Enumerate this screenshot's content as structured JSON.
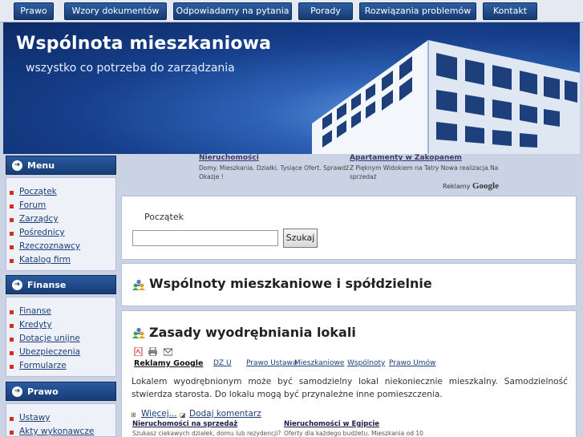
{
  "nav": {
    "items": [
      "Prawo",
      "Wzory dokumentów",
      "Odpowiadamy na pytania",
      "Porady",
      "Rozwiązania problemów",
      "Kontakt"
    ]
  },
  "header": {
    "title": "Wspólnota mieszkaniowa",
    "subtitle": "wszystko co potrzeba do zarządzania"
  },
  "sidebar": {
    "menu": {
      "title": "Menu",
      "items": [
        "Początek",
        "Forum",
        "Zarządcy",
        "Pośrednicy",
        "Rzeczoznawcy",
        "Katalog firm"
      ]
    },
    "finanse": {
      "title": "Finanse",
      "items": [
        "Finanse",
        "Kredyty",
        "Dotacje unijne",
        "Ubezpieczenia",
        "Formularze"
      ]
    },
    "prawo": {
      "title": "Prawo",
      "items": [
        "Ustawy",
        "Akty wykonawcze"
      ]
    }
  },
  "top_ads": [
    {
      "title": "Nieruchomości",
      "text": "Domy. Mieszkania. Działki. Tysiące Ofert. Sprawdź Okazje !"
    },
    {
      "title": "Apartamenty w Zakopanem",
      "text": "Z Pięknym Widokiem na Tatry Nowa realizacja.Na sprzedaż"
    }
  ],
  "reklamy": {
    "prefix": "Reklamy",
    "brand": "Google"
  },
  "search": {
    "breadcrumb": "Początek",
    "value": "",
    "button": "Szukaj"
  },
  "section_title": "Wspólnoty mieszkaniowe i spółdzielnie",
  "article": {
    "title": "Zasady wyodrębniania lokali",
    "ads_label": "Reklamy Google",
    "ad_links": [
      "DZ U",
      "Prawo Ustawa",
      "Mieszkaniowe",
      "Wspólnoty",
      "Prawo Umów"
    ],
    "text": "Lokalem wyodrębnionym może być samodzielny lokal niekoniecznie mieszkalny. Samodzielność stwierdza starosta. Do lokalu mogą być przynależne inne pomieszczenia.",
    "more": "Więcej...",
    "comment": "Dodaj komentarz",
    "bottom_ads": [
      {
        "title": "Nieruchomości na sprzedaż",
        "text": "Szukasz ciekawych działek, domu lub rezydencji?"
      },
      {
        "title": "Nieruchomości w Egipcie",
        "text": "Oferty dla każdego budżetu. Mieszkania od 10"
      }
    ]
  },
  "colors": {
    "nav": "#1f4a8a",
    "header": "#1a4590",
    "link": "#1a3f7a",
    "bullet": "#d2301e"
  }
}
